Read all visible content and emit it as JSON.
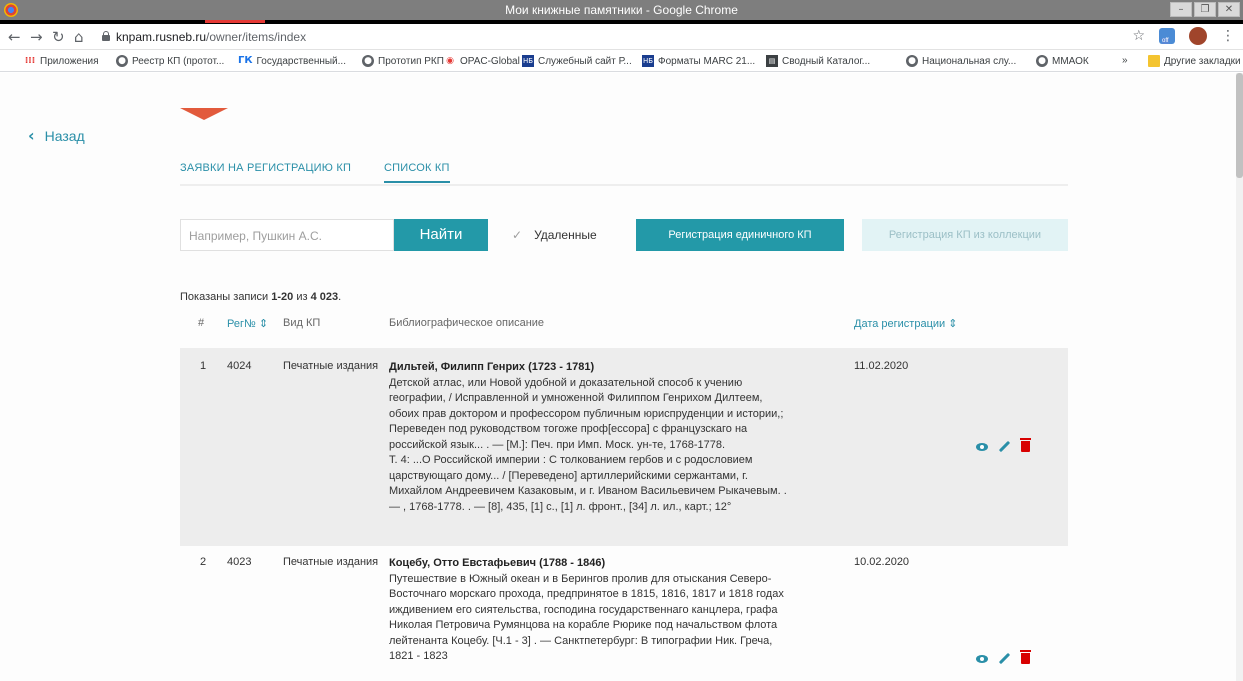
{
  "window": {
    "title": "Мои книжные памятники - Google Chrome",
    "controls": [
      "minimize",
      "restore",
      "close"
    ]
  },
  "address": {
    "host": "knpam.rusneb.ru",
    "path": "/owner/items/index"
  },
  "bookmarks": [
    {
      "label": "Приложения",
      "icon": "apps-icon"
    },
    {
      "label": "Реестр КП (протот...",
      "icon": "globe-icon"
    },
    {
      "label": "Государственный...",
      "icon": "gk-icon",
      "icon_text": "ГК"
    },
    {
      "label": "Прототип РКП",
      "icon": "globe-icon"
    },
    {
      "label": "OPAC-Global",
      "icon": "opac-icon"
    },
    {
      "label": "Служебный сайт Р...",
      "icon": "nb-icon",
      "icon_text": "НБ"
    },
    {
      "label": "Форматы MARC 21...",
      "icon": "nb-icon",
      "icon_text": "НБ"
    },
    {
      "label": "Сводный Каталог...",
      "icon": "catalog-icon"
    },
    {
      "label": "Национальная слу...",
      "icon": "globe-icon"
    },
    {
      "label": "ММАОК",
      "icon": "globe-icon"
    },
    {
      "label": "»",
      "icon": ""
    },
    {
      "label": "Другие закладки",
      "icon": "folder-icon"
    }
  ],
  "sidebar": {
    "back_label": "Назад"
  },
  "tabs": [
    {
      "label": "ЗАЯВКИ НА РЕГИСТРАЦИЮ КП",
      "active": false
    },
    {
      "label": "СПИСОК КП",
      "active": true
    }
  ],
  "search": {
    "placeholder": "Например, Пушкин А.С.",
    "find_label": "Найти",
    "deleted_label": "Удаленные",
    "register_single_label": "Регистрация единичного КП",
    "register_collection_label": "Регистрация КП из коллекции"
  },
  "summary": {
    "prefix": "Показаны записи ",
    "range": "1-20",
    "middle": " из ",
    "total": "4 023",
    "suffix": "."
  },
  "table": {
    "headers": {
      "num": "#",
      "reg": "Рег№ ⇕",
      "kind": "Вид КП",
      "desc": "Библиографическое описание",
      "date": "Дата регистрации ⇕"
    },
    "rows": [
      {
        "num": "1",
        "reg": "4024",
        "kind": "Печатные издания",
        "author": "Дильтей, Филипп Генрих (1723 - 1781)",
        "lines": [
          "Детской атлас, или Новой удобной и доказательной способ к учению",
          "географии, / Исправленной и умноженной Филиппом Генрихом Дилтеем,",
          "обоих прав доктором и профессором публичным юриспруденции и истории,;",
          "Переведен под руководством тогоже проф[ессора] с французскаго на",
          "российской язык... . — [М.]: Печ. при Имп. Моск. ун-те, 1768-1778.",
          "Т. 4: ...О Российской империи : С толкованием гербов и с родословием",
          "царствующаго дому... / [Переведено] артиллерийскими сержантами, г.",
          "Михайлом Андреевичем Казаковым, и г. Иваном Васильевичем Рыкачевым. .",
          "— , 1768-1778. . — [8], 435, [1] с., [1] л. фронт., [34] л. ил., карт.; 12°"
        ],
        "date": "11.02.2020"
      },
      {
        "num": "2",
        "reg": "4023",
        "kind": "Печатные издания",
        "author": "Коцебу, Отто Евстафьевич (1788 - 1846)",
        "lines": [
          "Путешествие в Южный океан и в Берингов пролив для отыскания Северо-",
          "Восточнаго морскаго прохода, предпринятое в 1815, 1816, 1817 и 1818 годах",
          "иждивением его сиятельства, господина государственнаго канцлера, графа",
          "Николая Петровича Румянцова на корабле Рюрике под начальством флота",
          "лейтенанта Коцебу. [Ч.1 - 3] . — Санктпетербург: В типографии Ник. Греча,",
          "1821 - 1823"
        ],
        "date": "10.02.2020"
      }
    ]
  },
  "colors": {
    "accent": "#2399a8",
    "link": "#2a8fa8",
    "delete": "#d80000",
    "row_shade": "#ededed"
  }
}
